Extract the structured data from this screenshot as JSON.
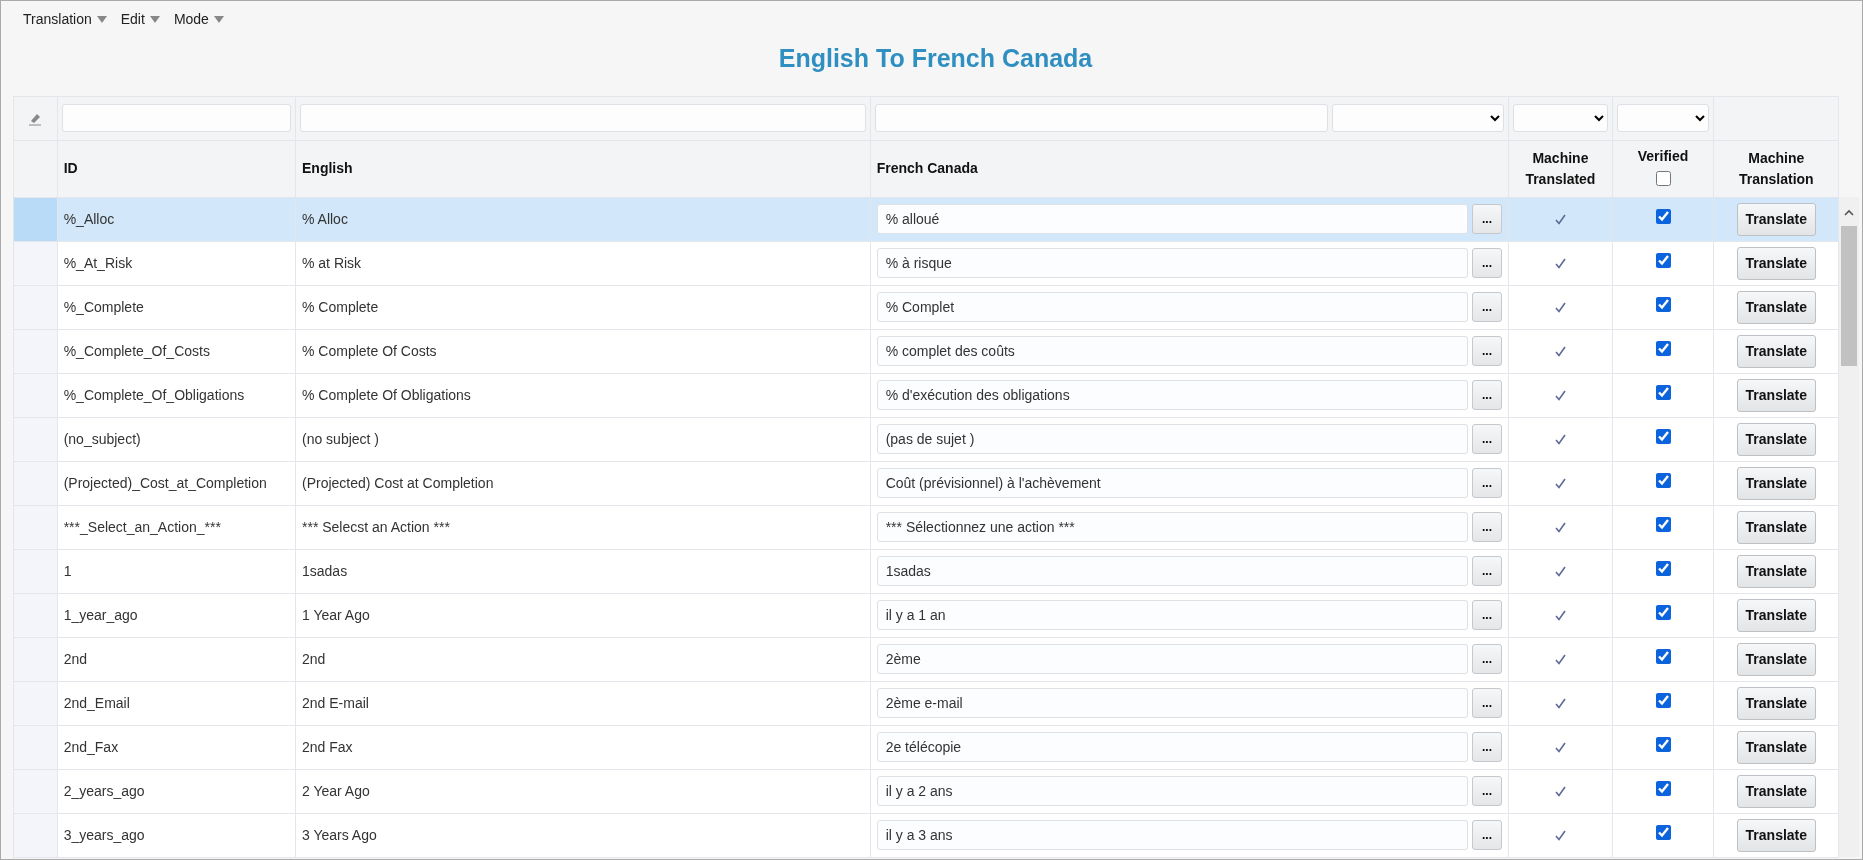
{
  "menu": [
    {
      "label": "Translation"
    },
    {
      "label": "Edit"
    },
    {
      "label": "Mode"
    }
  ],
  "title": "English To French Canada",
  "columns": [
    "ID",
    "English",
    "French Canada",
    "Machine Translated",
    "Verified",
    "Machine Translation"
  ],
  "header_verified_checked": false,
  "rows": [
    {
      "id": "%_Alloc",
      "english": "% Alloc",
      "french": "% alloué",
      "more": "...",
      "machine_translated": true,
      "verified": true,
      "button": "Translate",
      "selected": true
    },
    {
      "id": "%_At_Risk",
      "english": "% at Risk",
      "french": "% à risque",
      "more": "...",
      "machine_translated": true,
      "verified": true,
      "button": "Translate",
      "selected": false
    },
    {
      "id": "%_Complete",
      "english": "% Complete",
      "french": "% Complet",
      "more": "...",
      "machine_translated": true,
      "verified": true,
      "button": "Translate",
      "selected": false
    },
    {
      "id": "%_Complete_Of_Costs",
      "english": "% Complete Of Costs",
      "french": "% complet des coûts",
      "more": "...",
      "machine_translated": true,
      "verified": true,
      "button": "Translate",
      "selected": false
    },
    {
      "id": "%_Complete_Of_Obligations",
      "english": "% Complete Of Obligations",
      "french": "% d'exécution des obligations",
      "more": "...",
      "machine_translated": true,
      "verified": true,
      "button": "Translate",
      "selected": false
    },
    {
      "id": "(no_subject)",
      "english": "(no subject )",
      "french": "(pas de sujet )",
      "more": "...",
      "machine_translated": true,
      "verified": true,
      "button": "Translate",
      "selected": false
    },
    {
      "id": "(Projected)_Cost_at_Completion",
      "english": "(Projected) Cost at Completion",
      "french": "Coût (prévisionnel) à l'achèvement",
      "more": "...",
      "machine_translated": true,
      "verified": true,
      "button": "Translate",
      "selected": false
    },
    {
      "id": "***_Select_an_Action_***",
      "english": "*** Selecst an Action ***",
      "french": "*** Sélectionnez une action ***",
      "more": "...",
      "machine_translated": true,
      "verified": true,
      "button": "Translate",
      "selected": false
    },
    {
      "id": "1",
      "english": "1sadas",
      "french": "1sadas",
      "more": "...",
      "machine_translated": true,
      "verified": true,
      "button": "Translate",
      "selected": false
    },
    {
      "id": "1_year_ago",
      "english": "1 Year Ago",
      "french": "il y a 1 an",
      "more": "...",
      "machine_translated": true,
      "verified": true,
      "button": "Translate",
      "selected": false
    },
    {
      "id": "2nd",
      "english": "2nd",
      "french": "2ème",
      "more": "...",
      "machine_translated": true,
      "verified": true,
      "button": "Translate",
      "selected": false
    },
    {
      "id": "2nd_Email",
      "english": "2nd E-mail",
      "french": "2ème e-mail",
      "more": "...",
      "machine_translated": true,
      "verified": true,
      "button": "Translate",
      "selected": false
    },
    {
      "id": "2nd_Fax",
      "english": "2nd Fax",
      "french": "2e télécopie",
      "more": "...",
      "machine_translated": true,
      "verified": true,
      "button": "Translate",
      "selected": false
    },
    {
      "id": "2_years_ago",
      "english": "2 Year Ago",
      "french": "il y a 2 ans",
      "more": "...",
      "machine_translated": true,
      "verified": true,
      "button": "Translate",
      "selected": false
    },
    {
      "id": "3_years_ago",
      "english": "3 Years Ago",
      "french": "il y a 3 ans",
      "more": "...",
      "machine_translated": true,
      "verified": true,
      "button": "Translate",
      "selected": false
    }
  ]
}
